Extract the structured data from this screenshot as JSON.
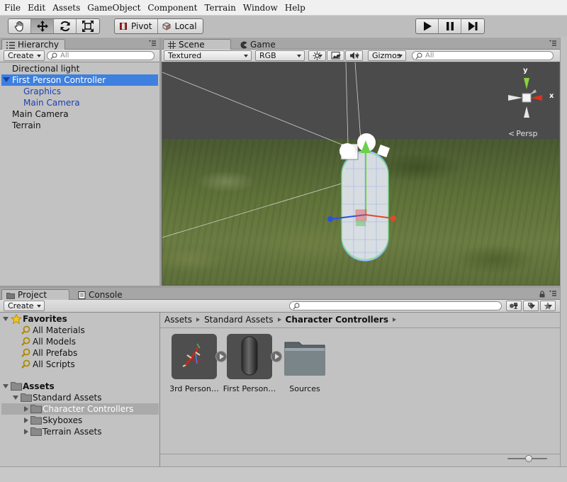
{
  "menu": {
    "items": [
      "File",
      "Edit",
      "Assets",
      "GameObject",
      "Component",
      "Terrain",
      "Window",
      "Help"
    ]
  },
  "toolbar": {
    "transform_tools": [
      {
        "icon": "hand-icon",
        "active": false
      },
      {
        "icon": "move-icon",
        "active": true
      },
      {
        "icon": "rotate-icon",
        "active": false
      },
      {
        "icon": "scale-icon",
        "active": false
      }
    ],
    "pivot_label": "Pivot",
    "local_label": "Local",
    "play_icon": "play-icon",
    "pause_icon": "pause-icon",
    "step_icon": "step-icon"
  },
  "hierarchy": {
    "tab_label": "Hierarchy",
    "create_label": "Create",
    "search_placeholder": "All",
    "items": [
      {
        "label": "Directional light",
        "selected": false,
        "child": false
      },
      {
        "label": "First Person Controller",
        "selected": true,
        "child": false,
        "expanded": true
      },
      {
        "label": "Graphics",
        "selected": false,
        "child": true
      },
      {
        "label": "Main Camera",
        "selected": false,
        "child": true
      },
      {
        "label": "Main Camera",
        "selected": false,
        "child": false
      },
      {
        "label": "Terrain",
        "selected": false,
        "child": false
      }
    ]
  },
  "scene": {
    "tab_label": "Scene",
    "game_tab_label": "Game",
    "render_mode": "Textured",
    "color_mode": "RGB",
    "gizmos_label": "Gizmos",
    "search_placeholder": "All",
    "axis_x": "x",
    "axis_y": "y",
    "projection_label": "Persp"
  },
  "project": {
    "tab_label": "Project",
    "console_tab_label": "Console",
    "create_label": "Create",
    "favorites": {
      "label": "Favorites",
      "items": [
        "All Materials",
        "All Models",
        "All Prefabs",
        "All Scripts"
      ]
    },
    "assets": {
      "label": "Assets",
      "standard_assets": "Standard Assets",
      "children": [
        {
          "label": "Character Controllers",
          "selected": true
        },
        {
          "label": "Skyboxes",
          "selected": false
        },
        {
          "label": "Terrain Assets",
          "selected": false
        }
      ]
    },
    "breadcrumb": [
      "Assets",
      "Standard Assets",
      "Character Controllers"
    ],
    "grid_items": [
      {
        "name": "3rd Person…",
        "kind": "prefab-3rd"
      },
      {
        "name": "First Person…",
        "kind": "prefab-fp"
      },
      {
        "name": "Sources",
        "kind": "folder"
      }
    ],
    "zoom_level": 0.55
  }
}
